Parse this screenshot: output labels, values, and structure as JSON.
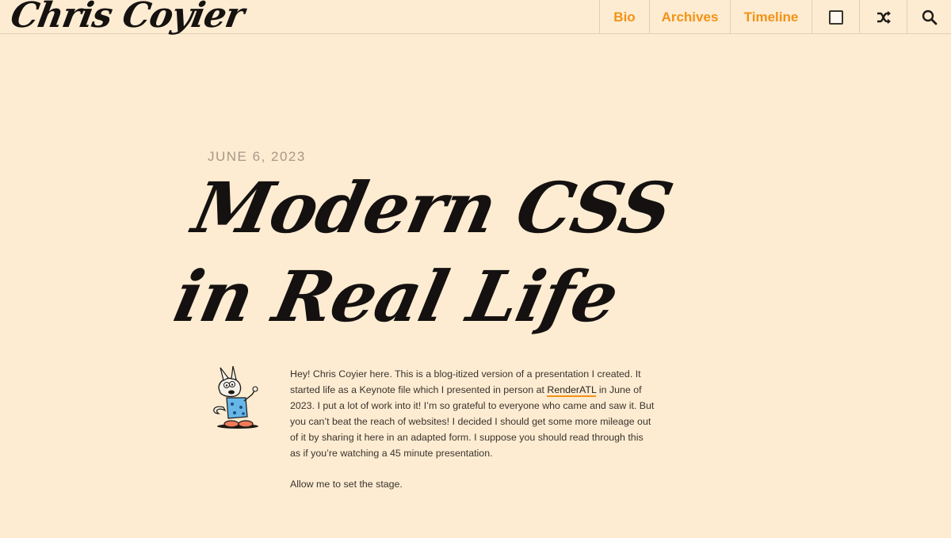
{
  "site": {
    "logo_text": "Chris Coyier"
  },
  "nav": {
    "items": [
      {
        "label": "Bio"
      },
      {
        "label": "Archives"
      },
      {
        "label": "Timeline"
      }
    ],
    "icons": [
      "checkbox-icon",
      "shuffle-icon",
      "search-icon"
    ]
  },
  "article": {
    "date": "JUNE 6, 2023",
    "title": "Modern CSS in Real Life",
    "intro_before_link": "Hey! Chris Coyier here. This is a blog-itized version of a presentation I created. It started life as a Keynote file which I presented in person at ",
    "intro_link": "RenderATL",
    "intro_after_link": " in June of 2023. I put a lot of work into it! I’m so grateful to everyone who came and saw it. But you can’t beat the reach of websites! I decided I should get some more mileage out of it by sharing it here in an adapted form. I suppose you should read through this as if you’re watching a 45 minute presentation.",
    "second_paragraph": "Allow me to set the stage."
  },
  "colors": {
    "background": "#fdecd2",
    "accent": "#f39215",
    "text": "#2b2520"
  }
}
